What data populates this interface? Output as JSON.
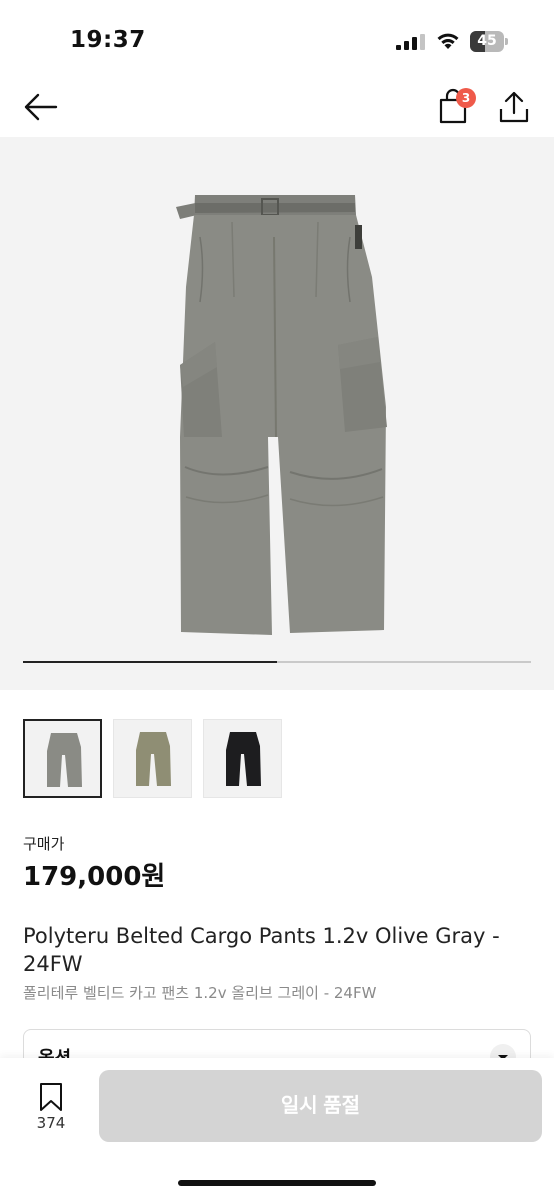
{
  "status_bar": {
    "time": "19:37",
    "battery": "45",
    "battery_level": 0.45
  },
  "nav": {
    "cart_badge": "3"
  },
  "gallery": {
    "current_index": 1,
    "total_images": 2
  },
  "thumbnails": [
    {
      "color": "#8a8b85",
      "selected": true
    },
    {
      "color": "#8f8e74",
      "selected": false
    },
    {
      "color": "#1d1d1f",
      "selected": false
    }
  ],
  "price": {
    "label": "구매가",
    "value": "179,000원"
  },
  "product": {
    "name": "Polyteru Belted Cargo Pants 1.2v Olive Gray - 24FW",
    "name_ko": "폴리테루 벨티드 카고 팬츠 1.2v 올리브 그레이 - 24FW"
  },
  "option": {
    "label": "옵션"
  },
  "bottom": {
    "wish_count": "374",
    "soldout_label": "일시 품절"
  },
  "colors": {
    "badge": "#ef5a4a",
    "disabled_button": "#d4d4d4",
    "pants": "#8a8b85"
  }
}
